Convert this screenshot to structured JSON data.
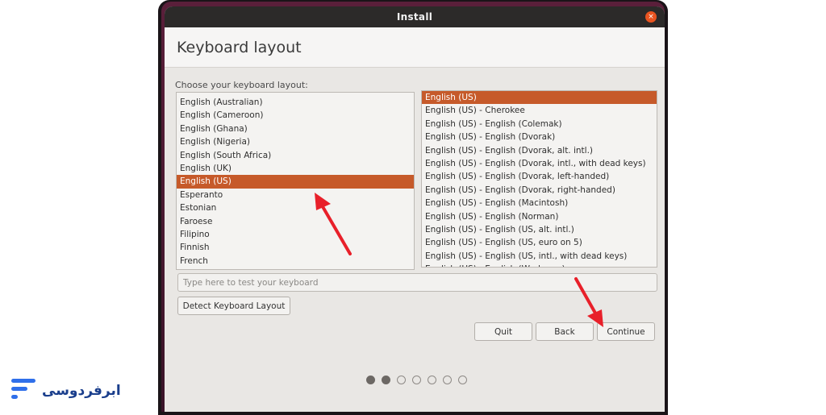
{
  "window": {
    "title": "Install",
    "close_glyph": "×"
  },
  "page": {
    "heading": "Keyboard layout",
    "prompt": "Choose your keyboard layout:"
  },
  "layouts": [
    "English (Australian)",
    "English (Cameroon)",
    "English (Ghana)",
    "English (Nigeria)",
    "English (South Africa)",
    "English (UK)",
    "English (US)",
    "Esperanto",
    "Estonian",
    "Faroese",
    "Filipino",
    "Finnish",
    "French"
  ],
  "selected_layout": "English (US)",
  "variants": [
    "English (US)",
    "English (US) - Cherokee",
    "English (US) - English (Colemak)",
    "English (US) - English (Dvorak)",
    "English (US) - English (Dvorak, alt. intl.)",
    "English (US) - English (Dvorak, intl., with dead keys)",
    "English (US) - English (Dvorak, left-handed)",
    "English (US) - English (Dvorak, right-handed)",
    "English (US) - English (Macintosh)",
    "English (US) - English (Norman)",
    "English (US) - English (US, alt. intl.)",
    "English (US) - English (US, euro on 5)",
    "English (US) - English (US, intl., with dead keys)",
    "English (US) - English (Workman)"
  ],
  "selected_variant": "English (US)",
  "test_input": {
    "value": "",
    "placeholder": "Type here to test your keyboard"
  },
  "buttons": {
    "detect": "Detect Keyboard Layout",
    "quit": "Quit",
    "back": "Back",
    "continue": "Continue"
  },
  "progress": {
    "total_steps": 7,
    "completed_steps": 2
  },
  "colors": {
    "selection": "#c65a2a",
    "arrow": "#e8202a",
    "close": "#e95420",
    "brand": "#2f6fea"
  },
  "brand": {
    "name": "ابرفردوسی",
    "logo_icon": "brand-logo-icon"
  }
}
